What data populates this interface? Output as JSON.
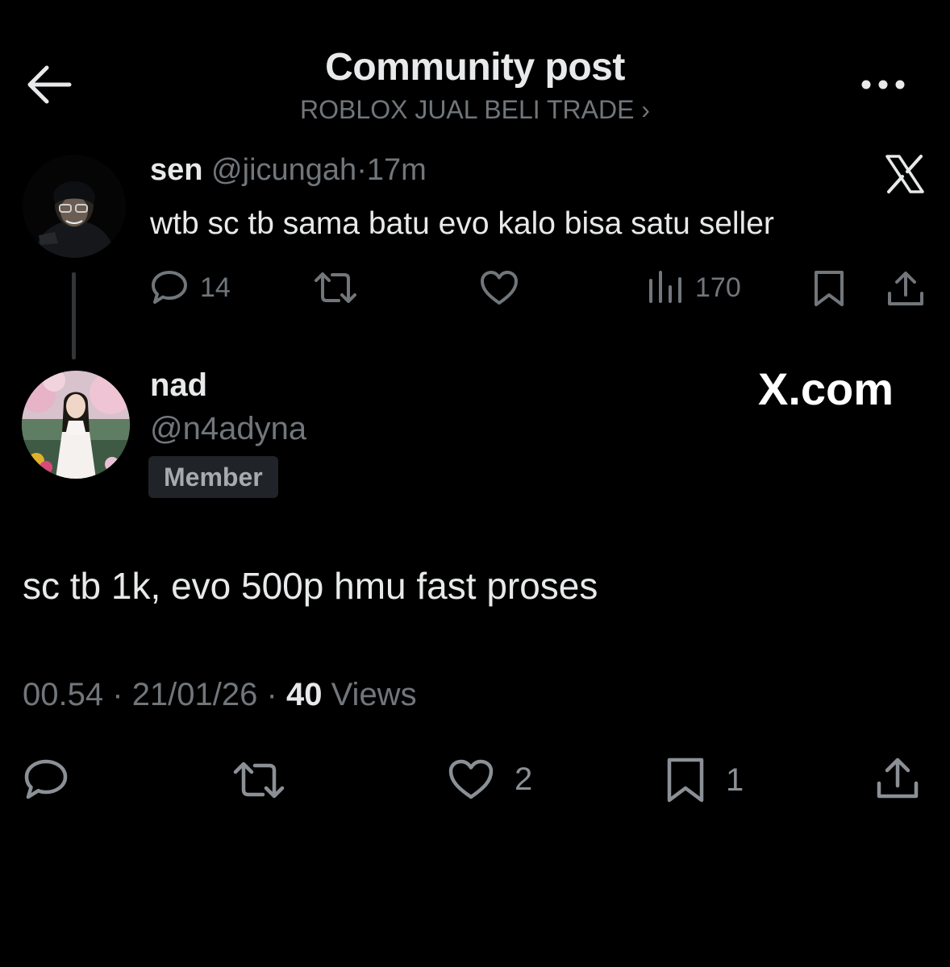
{
  "header": {
    "title": "Community post",
    "community": "ROBLOX JUAL BELI TRADE ›"
  },
  "parent_post": {
    "name": "sen",
    "handle": "@jicungah",
    "separator": "·",
    "time": "17m",
    "text": "wtb sc tb sama batu evo kalo bisa satu seller",
    "replies": "14",
    "views": "170"
  },
  "reply_post": {
    "name": "nad",
    "handle": "@n4adyna",
    "badge": "Member",
    "watermark": "X.com",
    "text": "sc tb 1k, evo 500p hmu fast proses",
    "time": "00.54",
    "date": "21/01/26",
    "views_count": "40",
    "views_label": "Views",
    "likes": "2",
    "bookmarks": "1"
  },
  "colors": {
    "background": "#000000",
    "primary_text": "#e7e9ea",
    "secondary_text": "#71767b",
    "badge_bg": "#202327"
  },
  "icons": [
    "back-arrow-icon",
    "more-icon",
    "x-logo-icon",
    "reply-icon",
    "repost-icon",
    "like-icon",
    "views-icon",
    "bookmark-icon",
    "share-icon"
  ]
}
